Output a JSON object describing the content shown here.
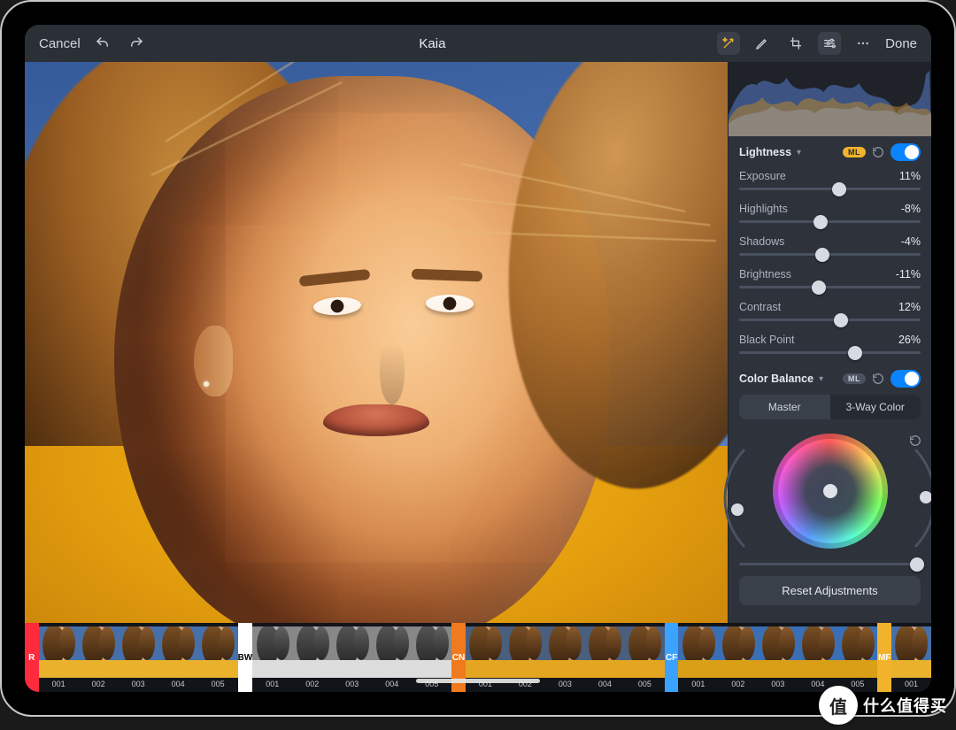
{
  "header": {
    "cancel": "Cancel",
    "title": "Kaia",
    "done": "Done"
  },
  "panel": {
    "lightness": {
      "title": "Lightness",
      "ml_label": "ML",
      "sliders": [
        {
          "label": "Exposure",
          "value": "11%",
          "pos": 55
        },
        {
          "label": "Highlights",
          "value": "-8%",
          "pos": 45
        },
        {
          "label": "Shadows",
          "value": "-4%",
          "pos": 46
        },
        {
          "label": "Brightness",
          "value": "-11%",
          "pos": 44
        },
        {
          "label": "Contrast",
          "value": "12%",
          "pos": 56
        },
        {
          "label": "Black Point",
          "value": "26%",
          "pos": 64
        }
      ]
    },
    "color_balance": {
      "title": "Color Balance",
      "ml_label": "ML",
      "tabs": {
        "master": "Master",
        "threeway": "3-Way Color"
      }
    },
    "reset_button": "Reset Adjustments"
  },
  "preset_groups": [
    {
      "tag": "R",
      "color": "#ff2a3b",
      "count": 5,
      "tone": "warm"
    },
    {
      "tag": "BW",
      "color": "#ffffff",
      "text": "#000",
      "count": 5,
      "tone": "bw"
    },
    {
      "tag": "CN",
      "color": "#f07a1d",
      "count": 5,
      "tone": "cine"
    },
    {
      "tag": "CF",
      "color": "#3ca2ff",
      "count": 5,
      "tone": "cool"
    },
    {
      "tag": "MF",
      "color": "#f2b32c",
      "count": 1,
      "tone": "mf"
    }
  ],
  "preset_label_prefix": "00",
  "watermark": {
    "badge": "值",
    "text": "什么值得买"
  }
}
